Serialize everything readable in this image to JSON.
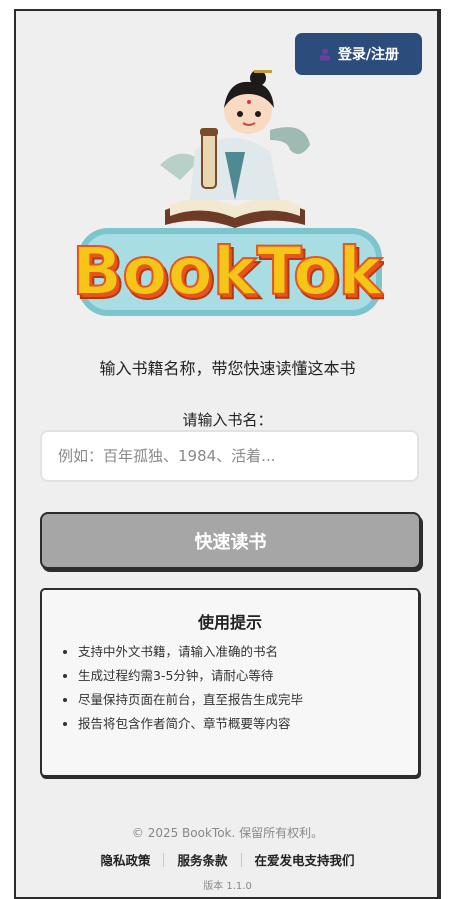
{
  "header": {
    "login_label": "登录/注册",
    "login_icon": "user-icon"
  },
  "brand": {
    "logo_text": "BookTok",
    "logo_colors": {
      "fill": "#f5c518",
      "shadow": "#e8541e",
      "outline": "#7dc4cf"
    }
  },
  "main": {
    "tagline": "输入书籍名称，带您快速读懂这本书",
    "input_label": "请输入书名：",
    "input_placeholder": "例如：百年孤独、1984、活着...",
    "input_value": "",
    "submit_label": "快速读书"
  },
  "tips": {
    "title": "使用提示",
    "items": [
      "支持中外文书籍，请输入准确的书名",
      "生成过程约需3-5分钟，请耐心等待",
      "尽量保持页面在前台，直至报告生成完毕",
      "报告将包含作者简介、章节概要等内容"
    ]
  },
  "footer": {
    "copyright": "© 2025 BookTok. 保留所有权利。",
    "links": [
      "隐私政策",
      "服务条款",
      "在爱发电支持我们"
    ],
    "version": "版本 1.1.0"
  }
}
